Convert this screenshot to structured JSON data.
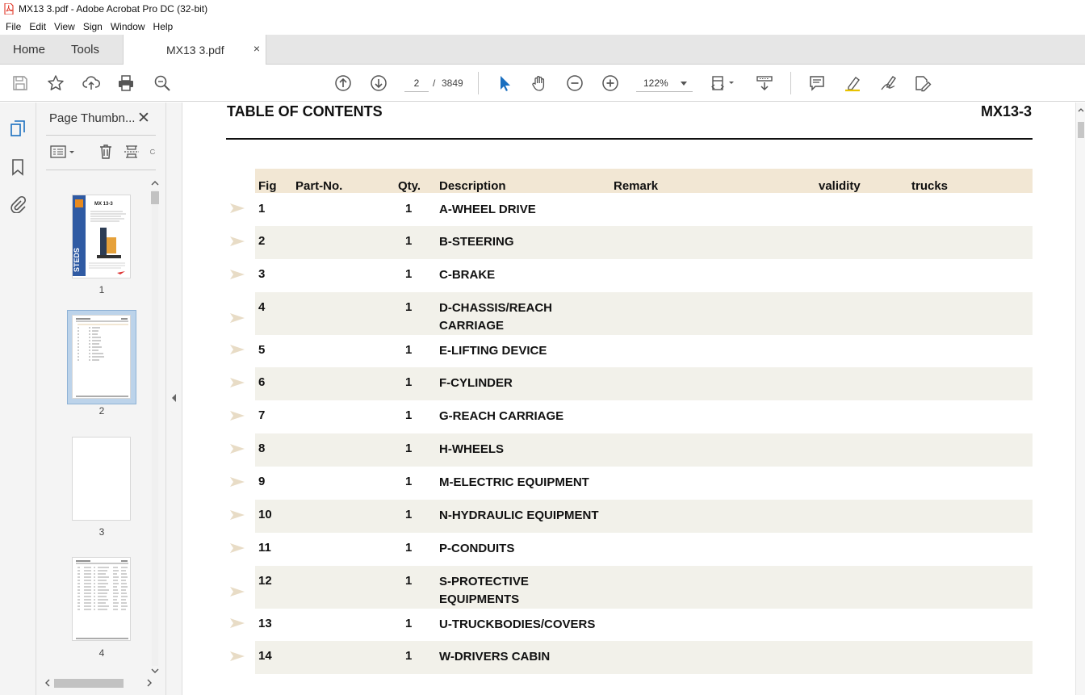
{
  "window": {
    "title": "MX13 3.pdf - Adobe Acrobat Pro DC (32-bit)"
  },
  "menu": [
    "File",
    "Edit",
    "View",
    "Sign",
    "Window",
    "Help"
  ],
  "tabs": {
    "home": "Home",
    "tools": "Tools",
    "document": "MX13 3.pdf",
    "close": "×"
  },
  "toolbar": {
    "page_current": "2",
    "page_sep": "/",
    "page_total": "3849",
    "zoom": "122%",
    "icons": [
      "save-icon",
      "star-icon",
      "upload-icon",
      "print-icon",
      "search-zoom-icon",
      "page-up-icon",
      "page-down-icon",
      "select-arrow-icon",
      "hand-icon",
      "zoom-out-icon",
      "zoom-in-icon",
      "fit-page-icon",
      "scroll-mode-icon",
      "comment-icon",
      "highlight-icon",
      "sign-icon",
      "edit-pdf-icon"
    ]
  },
  "panel": {
    "title": "Page Thumbn...",
    "close": "✕",
    "thumbnails": [
      {
        "page": "1",
        "cover_title": "MX 13-3",
        "cover_brand": "STEDS"
      },
      {
        "page": "2"
      },
      {
        "page": "3"
      },
      {
        "page": "4"
      }
    ]
  },
  "document": {
    "title": "TABLE OF CONTENTS",
    "code": "MX13-3",
    "columns": {
      "fig": "Fig",
      "part_no": "Part-No.",
      "qty": "Qty.",
      "description": "Description",
      "remark": "Remark",
      "validity": "validity",
      "trucks": "trucks"
    },
    "rows": [
      {
        "fig": "1",
        "qty": "1",
        "desc": "A-WHEEL DRIVE",
        "desc2": ""
      },
      {
        "fig": "2",
        "qty": "1",
        "desc": "B-STEERING",
        "desc2": ""
      },
      {
        "fig": "3",
        "qty": "1",
        "desc": "C-BRAKE",
        "desc2": ""
      },
      {
        "fig": "4",
        "qty": "1",
        "desc": "D-CHASSIS/REACH",
        "desc2": "CARRIAGE"
      },
      {
        "fig": "5",
        "qty": "1",
        "desc": "E-LIFTING DEVICE",
        "desc2": ""
      },
      {
        "fig": "6",
        "qty": "1",
        "desc": "F-CYLINDER",
        "desc2": ""
      },
      {
        "fig": "7",
        "qty": "1",
        "desc": "G-REACH CARRIAGE",
        "desc2": ""
      },
      {
        "fig": "8",
        "qty": "1",
        "desc": "H-WHEELS",
        "desc2": ""
      },
      {
        "fig": "9",
        "qty": "1",
        "desc": "M-ELECTRIC EQUIPMENT",
        "desc2": ""
      },
      {
        "fig": "10",
        "qty": "1",
        "desc": "N-HYDRAULIC EQUIPMENT",
        "desc2": ""
      },
      {
        "fig": "11",
        "qty": "1",
        "desc": "P-CONDUITS",
        "desc2": ""
      },
      {
        "fig": "12",
        "qty": "1",
        "desc": "S-PROTECTIVE",
        "desc2": "EQUIPMENTS"
      },
      {
        "fig": "13",
        "qty": "1",
        "desc": "U-TRUCKBODIES/COVERS",
        "desc2": ""
      },
      {
        "fig": "14",
        "qty": "1",
        "desc": "W-DRIVERS CABIN",
        "desc2": ""
      }
    ]
  },
  "colors": {
    "header_bg": "#f2e7d4",
    "row_shade": "#f2f1ea",
    "accent": "#1a6fc0",
    "arrow": "#e8dcc6"
  }
}
